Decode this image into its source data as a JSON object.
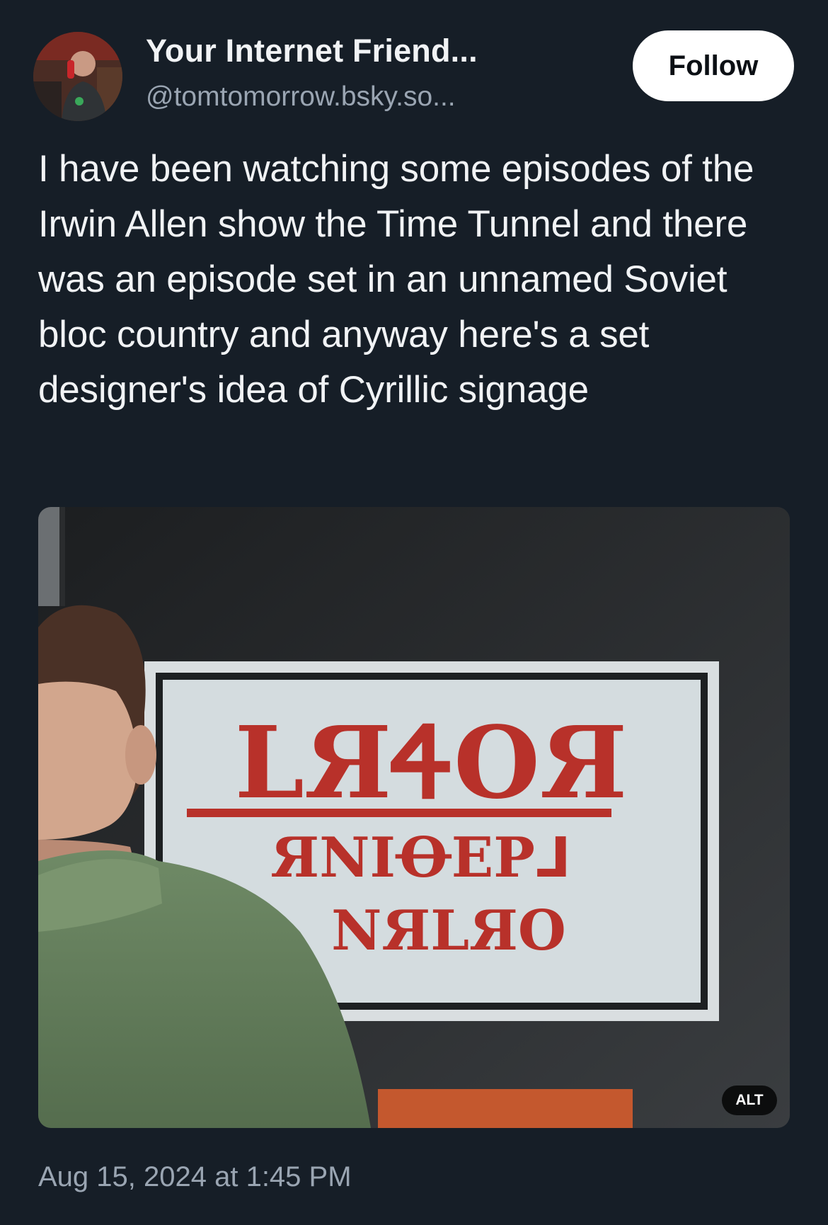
{
  "author": {
    "display_name": "Your Internet Friend...",
    "handle": "@tomtomorrow.bsky.so..."
  },
  "follow_label": "Follow",
  "post_text": "I have been watching some episodes of the Irwin Allen show the Time Tunnel and there was an episode set in an unnamed Soviet bloc country and anyway here's a set designer's idea of Cyrillic signage",
  "media": {
    "sign_lines": [
      "LЯᏎOЯ",
      "ЯNIꝊEP⅃",
      "NЯLЯO"
    ],
    "alt_label": "ALT"
  },
  "timestamp": "Aug 15, 2024 at 1:45 PM",
  "colors": {
    "background": "#161e27",
    "text_primary": "#f1f3f5",
    "text_secondary": "#9aa5b2",
    "sign_red": "#b8312a"
  }
}
